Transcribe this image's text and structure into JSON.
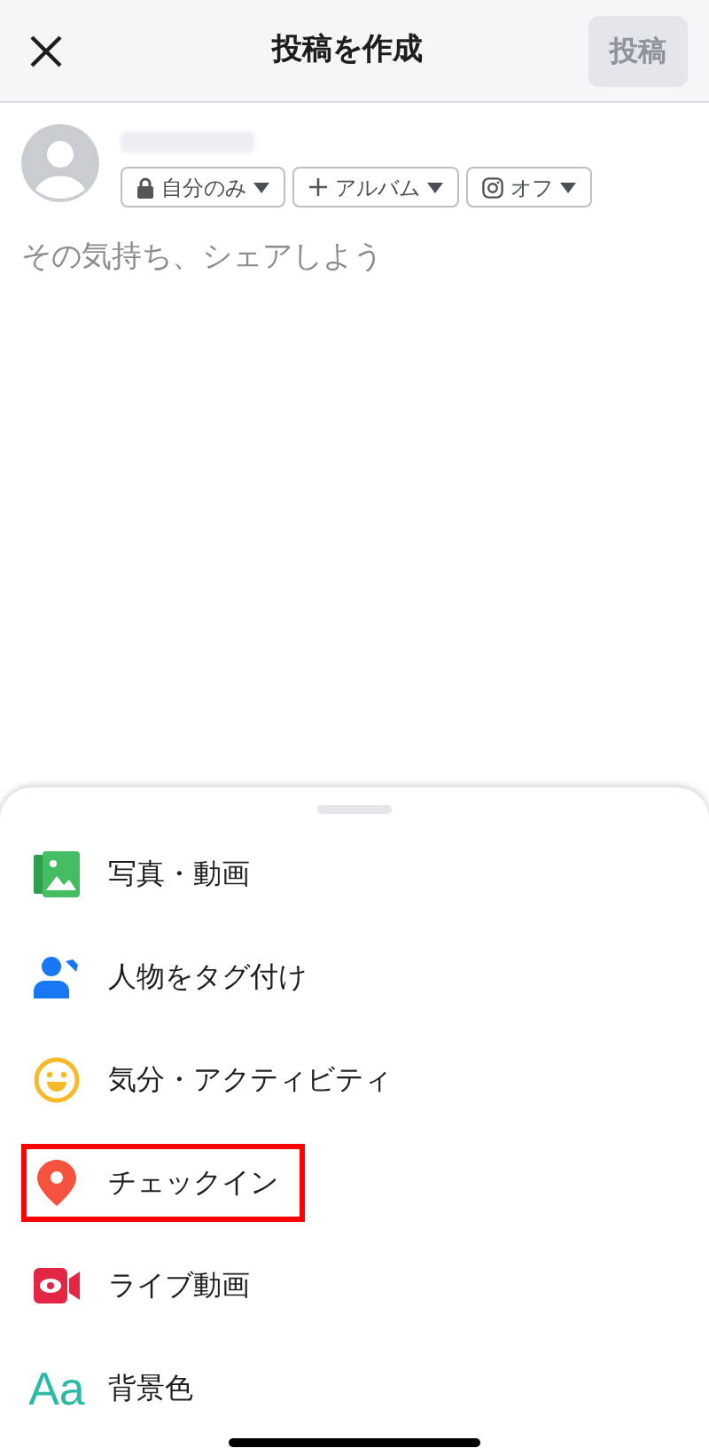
{
  "header": {
    "title": "投稿を作成",
    "post_button": {
      "label": "投稿",
      "disabled": true
    }
  },
  "audience_chips": [
    {
      "kind": "lock",
      "label": "自分のみ"
    },
    {
      "kind": "plus",
      "label": "アルバム"
    },
    {
      "kind": "instagram",
      "label": "オフ"
    }
  ],
  "composer": {
    "placeholder": "その気持ち、シェアしよう"
  },
  "actions": [
    {
      "kind": "photo",
      "label": "写真・動画",
      "highlighted": false
    },
    {
      "kind": "tag",
      "label": "人物をタグ付け",
      "highlighted": false
    },
    {
      "kind": "feeling",
      "label": "気分・アクティビティ",
      "highlighted": false
    },
    {
      "kind": "checkin",
      "label": "チェックイン",
      "highlighted": true
    },
    {
      "kind": "live",
      "label": "ライブ動画",
      "highlighted": false
    },
    {
      "kind": "background",
      "icon_text": "Aa",
      "label": "背景色",
      "highlighted": false
    }
  ]
}
